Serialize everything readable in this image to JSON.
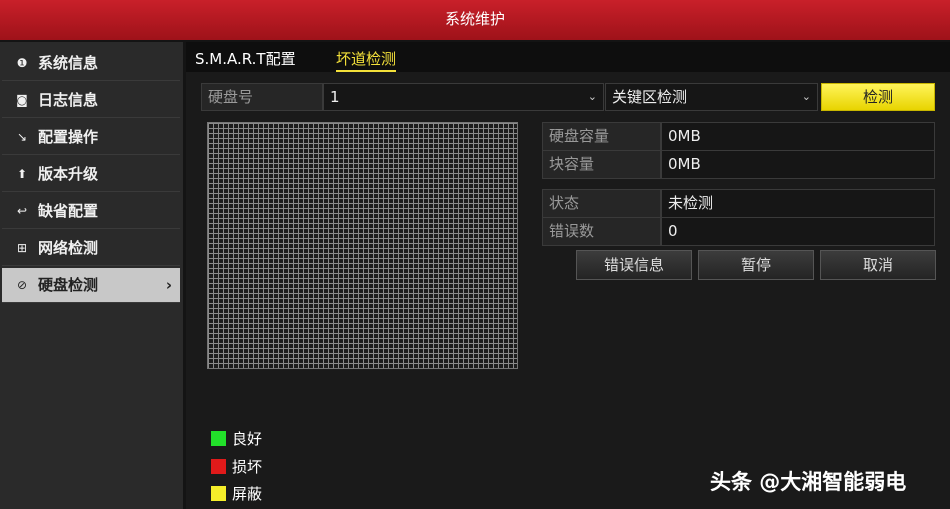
{
  "window": {
    "title": "系统维护"
  },
  "sidebar": {
    "items": [
      {
        "label": "系统信息",
        "icon": "info-circle-icon",
        "glyph": "❶"
      },
      {
        "label": "日志信息",
        "icon": "log-icon",
        "glyph": "◙"
      },
      {
        "label": "配置操作",
        "icon": "config-icon",
        "glyph": "↘"
      },
      {
        "label": "版本升级",
        "icon": "upgrade-arrow-icon",
        "glyph": "⬆"
      },
      {
        "label": "缺省配置",
        "icon": "reset-icon",
        "glyph": "↩"
      },
      {
        "label": "网络检测",
        "icon": "network-icon",
        "glyph": "⊞"
      },
      {
        "label": "硬盘检测",
        "icon": "disk-check-icon",
        "glyph": "⊘",
        "active": true,
        "arrow": "›"
      }
    ]
  },
  "tabs": [
    {
      "label": "S.M.A.R.T配置",
      "active": false
    },
    {
      "label": "坏道检测",
      "active": true
    }
  ],
  "form": {
    "disk_label": "硬盘号",
    "disk_value": "1",
    "mode_value": "关键区检测",
    "check_button": "检测"
  },
  "info": {
    "capacity_label": "硬盘容量",
    "capacity_value": "0MB",
    "block_label": "块容量",
    "block_value": "0MB",
    "status_label": "状态",
    "status_value": "未检测",
    "errors_label": "错误数",
    "errors_value": "0"
  },
  "actions": {
    "error_info": "错误信息",
    "pause": "暂停",
    "cancel": "取消"
  },
  "legend": [
    {
      "label": "良好",
      "color": "#22e02a"
    },
    {
      "label": "损坏",
      "color": "#e01a1a"
    },
    {
      "label": "屏蔽",
      "color": "#f5ee2a"
    }
  ],
  "watermark": "头条 @大湘智能弱电"
}
